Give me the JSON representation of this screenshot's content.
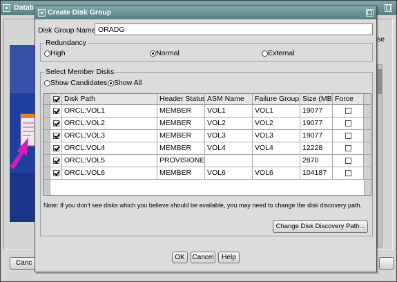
{
  "background_window": {
    "title": "Datab",
    "side_label": "se",
    "cancel_button": "Canc"
  },
  "dialog": {
    "title": "Create Disk Group",
    "disk_group_name": {
      "label": "Disk Group Name:",
      "value": "ORADG"
    },
    "redundancy": {
      "legend": "Redundancy",
      "options": [
        {
          "label": "High",
          "selected": false
        },
        {
          "label": "Normal",
          "selected": true
        },
        {
          "label": "External",
          "selected": false
        }
      ]
    },
    "member_disks": {
      "legend": "Select Member Disks",
      "filters": [
        {
          "label": "Show Candidates",
          "selected": false
        },
        {
          "label": "Show All",
          "selected": true
        }
      ],
      "table": {
        "select_all": true,
        "columns": [
          "Disk Path",
          "Header Status",
          "ASM Name",
          "Failure Group",
          "Size (MB)",
          "Force"
        ],
        "rows": [
          {
            "selected": true,
            "disk_path": "ORCL:VOL1",
            "header_status": "MEMBER",
            "asm_name": "VOL1",
            "failure_group": "VOL1",
            "size_mb": "19077",
            "force": false
          },
          {
            "selected": true,
            "disk_path": "ORCL:VOL2",
            "header_status": "MEMBER",
            "asm_name": "VOL2",
            "failure_group": "VOL2",
            "size_mb": "19077",
            "force": false
          },
          {
            "selected": true,
            "disk_path": "ORCL:VOL3",
            "header_status": "MEMBER",
            "asm_name": "VOL3",
            "failure_group": "VOL3",
            "size_mb": "19077",
            "force": false
          },
          {
            "selected": true,
            "disk_path": "ORCL:VOL4",
            "header_status": "MEMBER",
            "asm_name": "VOL4",
            "failure_group": "VOL4",
            "size_mb": "12228",
            "force": false
          },
          {
            "selected": true,
            "disk_path": "ORCL:VOL5",
            "header_status": "PROVISIONED",
            "asm_name": "",
            "failure_group": "",
            "size_mb": "2870",
            "force": false
          },
          {
            "selected": true,
            "disk_path": "ORCL:VOL6",
            "header_status": "MEMBER",
            "asm_name": "VOL6",
            "failure_group": "VOL6",
            "size_mb": "104187",
            "force": false
          }
        ]
      },
      "note": "Note: If you don't see disks which you believe should be available, you may need to change the disk discovery path.",
      "change_path_button": "Change Disk Discovery Path..."
    },
    "buttons": {
      "ok": "OK",
      "cancel": "Cancel",
      "help": "Help"
    }
  },
  "colors": {
    "title_bar": "#5c8f8f",
    "banner_blue": "#1f3f9f",
    "arrow_magenta": "#d81cb8",
    "doc_header": "#e2832f"
  },
  "icons": {
    "window_menu": "window-menu-icon",
    "maximize": "maximize-icon",
    "checkbox": "checkbox",
    "radio": "radio-button"
  }
}
